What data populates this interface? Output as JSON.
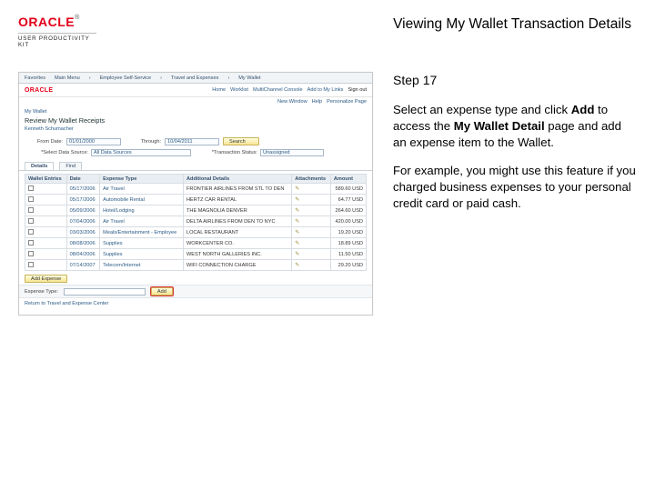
{
  "header": {
    "logo_brand": "ORACLE",
    "logo_tm": "®",
    "logo_sub": "USER PRODUCTIVITY KIT",
    "title": "Viewing My Wallet Transaction Details"
  },
  "instructions": {
    "step_label": "Step 17",
    "p1_a": "Select an expense type and click ",
    "p1_b": "Add",
    "p1_c": " to access the ",
    "p1_d": "My Wallet Detail",
    "p1_e": " page and add an expense item to the Wallet.",
    "p2": "For example, you might use this feature if you charged business expenses to your personal credit card or paid cash."
  },
  "screenshot": {
    "nav": {
      "favorites": "Favorites",
      "main": "Main Menu",
      "path1": "Employee Self-Service",
      "path2": "Travel and Expenses",
      "path3": "My Wallet"
    },
    "brandrow": {
      "oracle": "ORACLE",
      "links": [
        "Home",
        "Worklist",
        "MultiChannel Console",
        "Add to My Links",
        "Sign out"
      ]
    },
    "subheader": {
      "newwin": "New Window",
      "help": "Help",
      "personalize": "Personalize Page"
    },
    "crumb": "My Wallet",
    "page_title": "Review My Wallet Receipts",
    "person": "Kenneth Schumacher",
    "filters": {
      "from_label": "From Date:",
      "from_value": "01/01/2000",
      "thru_label": "Through:",
      "thru_value": "10/04/2011",
      "search_btn": "Search"
    },
    "filters2": {
      "src_label": "*Select Data Source:",
      "src_value": "All Data Sources",
      "status_label": "*Transaction Status:",
      "status_value": "Unassigned"
    },
    "tabs": {
      "details": "Details",
      "find": "Find"
    },
    "grid": {
      "headers": [
        "Wallet Entries",
        "Date",
        "Expense Type",
        "Additional Details",
        "Attachments",
        "Amount"
      ],
      "rows": [
        {
          "date": "05/17/2006",
          "type": "Air Travel",
          "details": "FRONTIER AIRLINES FROM STL TO DEN",
          "amount": "589.60 USD"
        },
        {
          "date": "05/17/2006",
          "type": "Automobile Rental",
          "details": "HERTZ CAR RENTAL",
          "amount": "64.77 USD"
        },
        {
          "date": "05/09/2006",
          "type": "Hotel/Lodging",
          "details": "THE MAGNOLIA DENVER",
          "amount": "264.60 USD"
        },
        {
          "date": "07/04/2006",
          "type": "Air Travel",
          "details": "DELTA AIRLINES FROM DEN TO NYC",
          "amount": "420.00 USD"
        },
        {
          "date": "03/03/2006",
          "type": "Meals/Entertainment - Employee",
          "details": "LOCAL RESTAURANT",
          "amount": "19.20 USD"
        },
        {
          "date": "08/08/2006",
          "type": "Supplies",
          "details": "WORKCENTER CO.",
          "amount": "18.89 USD"
        },
        {
          "date": "08/04/2006",
          "type": "Supplies",
          "details": "WEST NORTH GALLERIES INC.",
          "amount": "11.50 USD"
        },
        {
          "date": "07/14/2007",
          "type": "Telecom/Internet",
          "details": "WIFI CONNECTION CHARGE",
          "amount": "29.20 USD"
        }
      ]
    },
    "below": {
      "add_expense": "Add Expense"
    },
    "typebar": {
      "label": "Expense Type:",
      "add_btn": "Add"
    },
    "footerlink": "Return to Travel and Expense Center"
  }
}
